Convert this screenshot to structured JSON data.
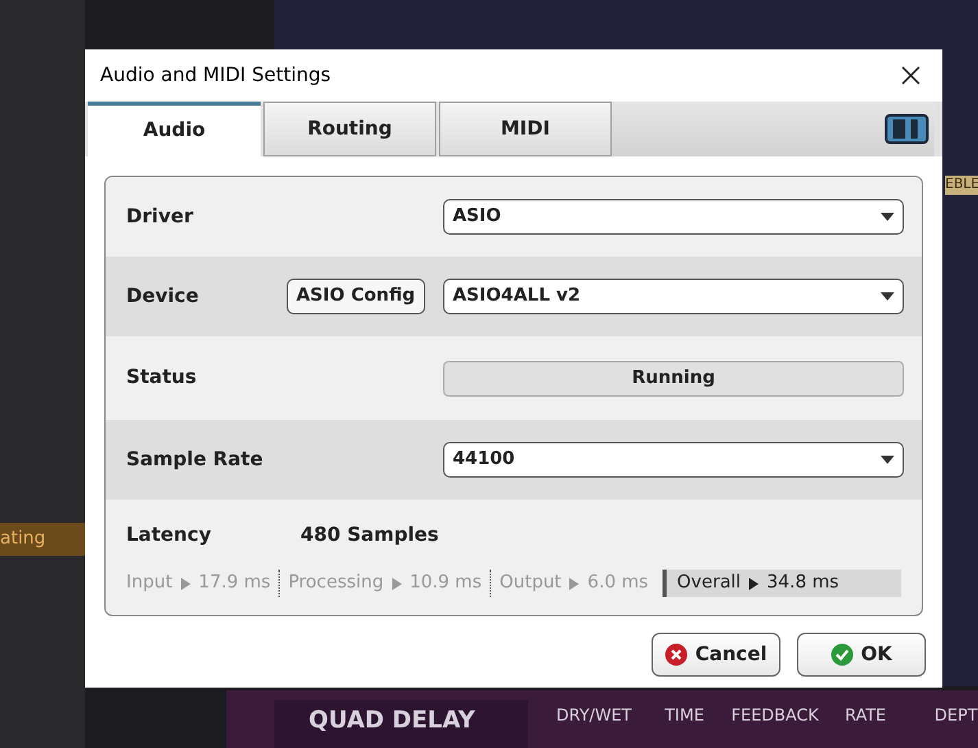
{
  "window": {
    "title": "Audio and MIDI Settings"
  },
  "tabs": [
    {
      "label": "Audio",
      "selected": true
    },
    {
      "label": "Routing",
      "selected": false
    },
    {
      "label": "MIDI",
      "selected": false
    }
  ],
  "rows": [
    {
      "kind": "dropdown",
      "label": "Driver",
      "value": "ASIO"
    },
    {
      "kind": "dropdown",
      "label": "Device",
      "button": "ASIO Config",
      "value": "ASIO4ALL v2"
    },
    {
      "kind": "status",
      "label": "Status",
      "value": "Running"
    },
    {
      "kind": "dropdown",
      "label": "Sample Rate",
      "value": "44100"
    }
  ],
  "latency": {
    "label": "Latency",
    "value": "480 Samples",
    "stages": [
      {
        "label": "Input",
        "value": "17.9 ms",
        "highlighted": false
      },
      {
        "label": "Processing",
        "value": "10.9 ms",
        "highlighted": false
      },
      {
        "label": "Output",
        "value": "6.0 ms",
        "highlighted": false
      },
      {
        "label": "Overall",
        "value": "34.8 ms",
        "highlighted": true
      }
    ]
  },
  "buttons": [
    {
      "kind": "cancel",
      "label": "Cancel"
    },
    {
      "kind": "ok",
      "label": "OK"
    }
  ],
  "background": {
    "left_label": "ating",
    "right_label": "EBLE",
    "plugin": {
      "title": "QUAD DELAY",
      "knobs": [
        "DRY/WET",
        "TIME",
        "FEEDBACK",
        "RATE",
        "DEPT"
      ]
    }
  }
}
